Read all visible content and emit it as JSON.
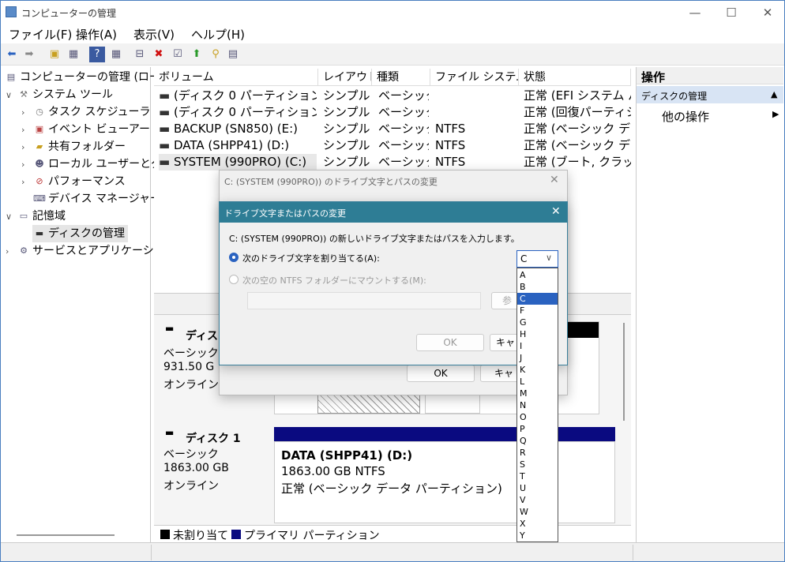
{
  "window": {
    "title": "コンピューターの管理",
    "minimize": "—",
    "maximize": "☐",
    "close": "✕"
  },
  "menu": [
    "ファイル(F)",
    "操作(A)",
    "表示(V)",
    "ヘルプ(H)"
  ],
  "tree": {
    "root": "コンピューターの管理 (ロー",
    "system_tools": "システム ツール",
    "task_scheduler": "タスク スケジューラ",
    "event_viewer": "イベント ビューアー",
    "shared_folders": "共有フォルダー",
    "local_users": "ローカル ユーザーとグ",
    "performance": "パフォーマンス",
    "device_manager": "デバイス マネージャー",
    "storage": "記憶域",
    "disk_management": "ディスクの管理",
    "services": "サービスとアプリケーション"
  },
  "volumes": {
    "headers": [
      "ボリューム",
      "レイアウト",
      "種類",
      "ファイル システム",
      "状態"
    ],
    "rows": [
      {
        "name": "(ディスク 0 パーティション 1)",
        "layout": "シンプル",
        "type": "ベーシック",
        "fs": "",
        "status": "正常 (EFI システム パ"
      },
      {
        "name": "(ディスク 0 パーティション 4)",
        "layout": "シンプル",
        "type": "ベーシック",
        "fs": "",
        "status": "正常 (回復パーティシ"
      },
      {
        "name": "BACKUP (SN850) (E:)",
        "layout": "シンプル",
        "type": "ベーシック",
        "fs": "NTFS",
        "status": "正常 (ベーシック デー"
      },
      {
        "name": "DATA (SHPP41) (D:)",
        "layout": "シンプル",
        "type": "ベーシック",
        "fs": "NTFS",
        "status": "正常 (ベーシック デー"
      },
      {
        "name": "SYSTEM (990PRO) (C:)",
        "layout": "シンプル",
        "type": "ベーシック",
        "fs": "NTFS",
        "status": "正常 (ブート, クラッシ"
      }
    ]
  },
  "disk0": {
    "name": "ディスク",
    "type": "ベーシック",
    "size": "931.50 G",
    "state": "オンライン"
  },
  "disk1": {
    "name": "ディスク 1",
    "type": "ベーシック",
    "size": "1863.00 GB",
    "state": "オンライン",
    "part_name": "DATA (SHPP41)  (D:)",
    "part_size": "1863.00 GB NTFS",
    "part_status": "正常 (ベーシック データ パーティション)"
  },
  "legend": {
    "unallocated": "未割り当て",
    "primary": "プライマリ パーティション"
  },
  "actions": {
    "header": "操作",
    "section": "ディスクの管理",
    "other": "他の操作"
  },
  "outer_dialog": {
    "title": "C: (SYSTEM (990PRO)) のドライブ文字とパスの変更",
    "ok": "OK",
    "cancel": "キャ"
  },
  "inner_dialog": {
    "title": "ドライブ文字またはパスの変更",
    "prompt": "C: (SYSTEM (990PRO)) の新しいドライブ文字またはパスを入力します。",
    "radio_assign": "次のドライブ文字を割り当てる(A):",
    "radio_mount": "次の空の NTFS フォルダーにマウントする(M):",
    "browse": "参",
    "ok": "OK",
    "cancel": "キャ",
    "selected": "C"
  },
  "drive_letters": [
    "A",
    "B",
    "C",
    "F",
    "G",
    "H",
    "I",
    "J",
    "K",
    "L",
    "M",
    "N",
    "O",
    "P",
    "Q",
    "R",
    "S",
    "T",
    "U",
    "V",
    "W",
    "X",
    "Y"
  ],
  "colors": {
    "primary_partition": "#0a0a80",
    "selection": "#2a62c0",
    "dialog_header": "#2e7d95"
  }
}
